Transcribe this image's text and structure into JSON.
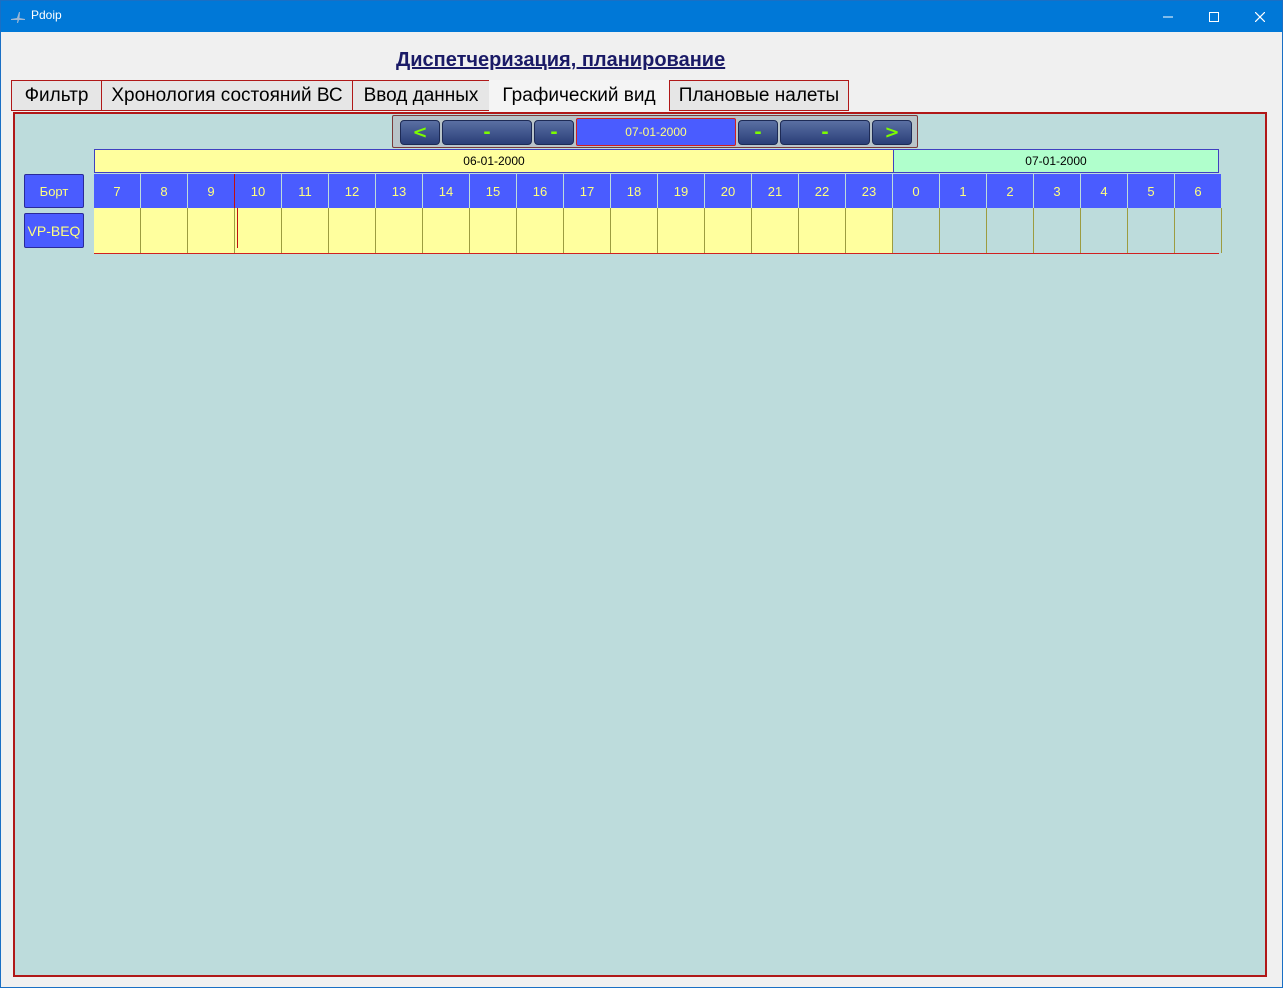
{
  "window": {
    "title": "Pdoip",
    "minimize_symbol": "—",
    "maximize_symbol": "☐",
    "close_symbol": "✕"
  },
  "page": {
    "title": "Диспетчеризация, планирование"
  },
  "tabs": [
    {
      "label": "Фильтр"
    },
    {
      "label": "Хронология состояний ВС"
    },
    {
      "label": "Ввод данных"
    },
    {
      "label": "Графический вид"
    },
    {
      "label": "Плановые налеты"
    }
  ],
  "navigator": {
    "prev_label": "<",
    "dash1_label": "-",
    "dash2_label": "-",
    "current_date": "07-01-2000",
    "dash3_label": "-",
    "dash4_label": "-",
    "next_label": ">"
  },
  "timeline": {
    "days": [
      {
        "label": "06-01-2000"
      },
      {
        "label": "07-01-2000"
      }
    ],
    "hours": [
      "7",
      "8",
      "9",
      "10",
      "11",
      "12",
      "13",
      "14",
      "15",
      "16",
      "17",
      "18",
      "19",
      "20",
      "21",
      "22",
      "23",
      "0",
      "1",
      "2",
      "3",
      "4",
      "5",
      "6"
    ],
    "header_label": "Борт",
    "aircraft": [
      {
        "label": "VP-BEQ"
      }
    ]
  },
  "colors": {
    "title_bar": "#0078d7",
    "panel_bg": "#bddcdc",
    "hour_cell": "#4a5cff",
    "hour_text": "#ffff80",
    "day1": "#ffff9e",
    "day2": "#b0ffcc",
    "nav_arrow": "#7cfc00",
    "border_accent": "#b01818"
  },
  "icons": {
    "app": "airplane-icon"
  }
}
